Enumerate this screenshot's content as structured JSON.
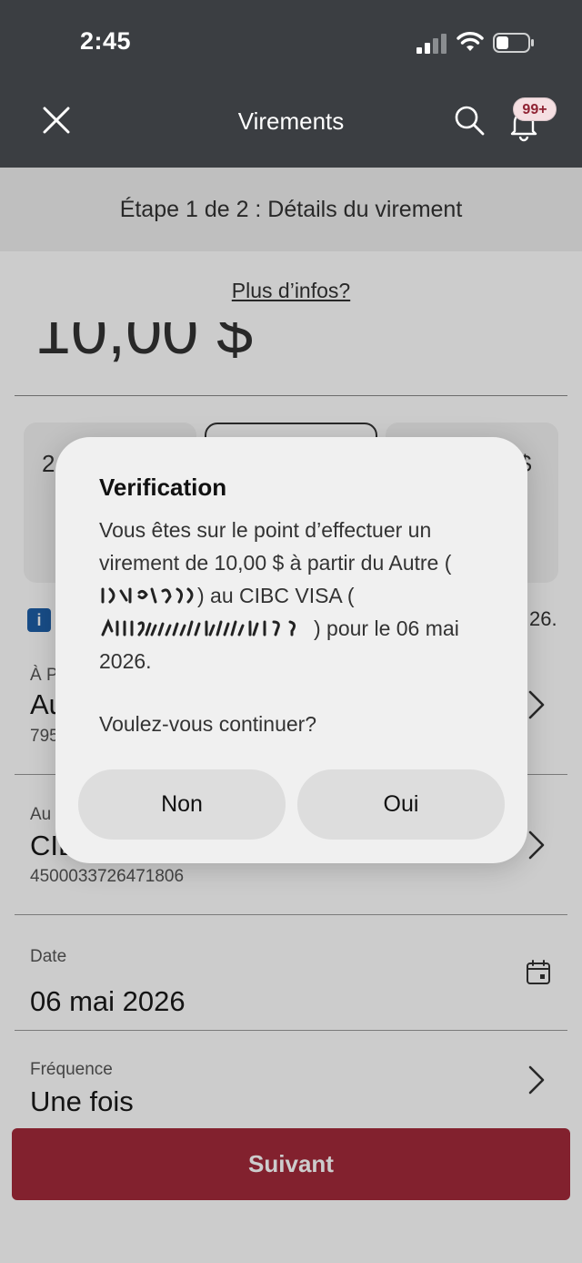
{
  "status_bar": {
    "time": "2:45"
  },
  "nav": {
    "title": "Virements",
    "notification_count": "99+"
  },
  "step": {
    "text": "Étape 1 de 2 : Détails du virement"
  },
  "main": {
    "more_info": "Plus d’infos?",
    "amount": "10,00 $",
    "chips": [
      {
        "text": "2"
      },
      {
        "text": ""
      },
      {
        "text": "$"
      }
    ],
    "info_tail": "26.",
    "from": {
      "label": "À P",
      "value": "Au",
      "sub": "795"
    },
    "to": {
      "label": "Au",
      "value": "CIB",
      "sub": "4500033726471806"
    },
    "date": {
      "label": "Date",
      "value": "06 mai 2026"
    },
    "frequency": {
      "label": "Fréquence",
      "value": "Une fois"
    },
    "next_label": "Suivant"
  },
  "dialog": {
    "title": "Verification",
    "message_part1": "Vous êtes sur le point d’effectuer un virement de 10,00 $ à partir du Autre (",
    "message_part2": ") au CIBC VISA (",
    "message_part3": ") pour le 06 mai 2026.",
    "question": "Voulez-vous continuer?",
    "no_label": "Non",
    "yes_label": "Oui"
  },
  "colors": {
    "header": "#3b3e42",
    "primary": "#a32a3a",
    "badge_text": "#8f2333",
    "info": "#1f5fa8"
  }
}
